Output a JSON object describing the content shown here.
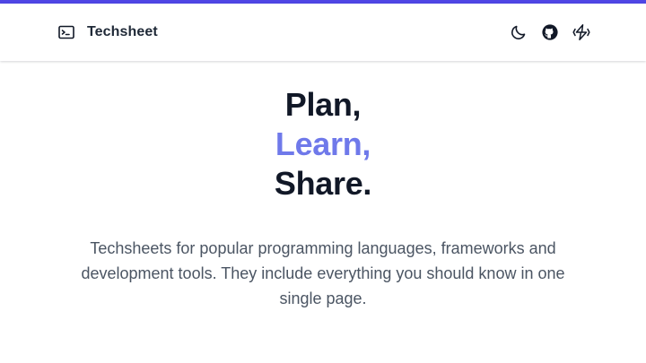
{
  "colors": {
    "accent_bar": "#4f46e5",
    "accent_text": "#6f79ea",
    "heading": "#111827",
    "body_text": "#4b5563"
  },
  "header": {
    "brand": {
      "icon": "terminal-icon",
      "name": "Techsheet"
    },
    "actions": [
      {
        "icon": "moon-icon"
      },
      {
        "icon": "github-icon"
      },
      {
        "icon": "lightning-icon"
      }
    ]
  },
  "hero": {
    "line1": "Plan,",
    "line2": "Learn,",
    "line3": "Share.",
    "description": "Techsheets for popular programming languages, frameworks and development tools. They include everything you should know in one single page."
  }
}
